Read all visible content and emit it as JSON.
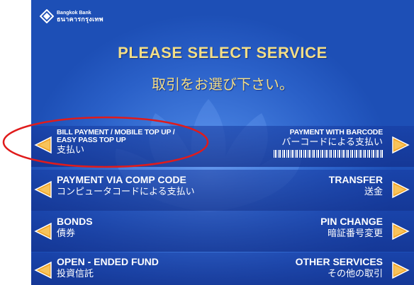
{
  "brand": {
    "name_en": "Bangkok Bank",
    "name_th": "ธนาคารกรุงเทพ"
  },
  "header": {
    "title_en": "PLEASE SELECT SERVICE",
    "title_jp": "取引をお選び下さい。"
  },
  "options": {
    "bill_payment": {
      "en_line1": "BILL PAYMENT / MOBILE TOP UP /",
      "en_line2": "EASY PASS TOP UP",
      "jp": "支払い"
    },
    "barcode_payment": {
      "en": "PAYMENT WITH BARCODE",
      "jp": "バーコードによる支払い"
    },
    "comp_code": {
      "en": "PAYMENT VIA COMP CODE",
      "jp": "コンピュータコードによる支払い"
    },
    "transfer": {
      "en": "TRANSFER",
      "jp": "送金"
    },
    "bonds": {
      "en": "BONDS",
      "jp": "債券"
    },
    "pin_change": {
      "en": "PIN CHANGE",
      "jp": "暗証番号変更"
    },
    "open_ended_fund": {
      "en": "OPEN - ENDED FUND",
      "jp": "投資信託"
    },
    "other_services": {
      "en": "OTHER SERVICES",
      "jp": "その他の取引"
    }
  },
  "colors": {
    "title": "#f3de86",
    "background": "#2a60c8",
    "arrow": "#f0a52a",
    "highlight": "#e01b1b"
  },
  "icons": {
    "logo": "bangkok-bank-logo",
    "left_arrow": "arrow-left-icon",
    "right_arrow": "arrow-right-icon"
  }
}
